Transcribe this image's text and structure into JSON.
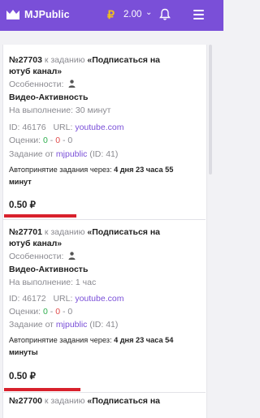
{
  "header": {
    "logo_text": "MJPublic",
    "currency_icon": "ruble-icon",
    "balance": "2.00",
    "colors": {
      "bar": "#7a4fd8",
      "ruble": "#f3c318"
    }
  },
  "tasks": [
    {
      "number": "№27703",
      "to_task_label": "к заданию",
      "title_line1": "«Подписаться на",
      "title_line2": "ютуб канал»",
      "features_label": "Особенности:",
      "category": "Видео-Активность",
      "duration_label": "На выполнение:",
      "duration": "30 минут",
      "id_label": "ID:",
      "id": "46176",
      "url_label": "URL:",
      "url": "youtube.com",
      "ratings_label": "Оценки:",
      "rating_pos": "0",
      "rating_dash1": "-",
      "rating_neg": "0",
      "rating_dash2": "-",
      "rating_other": "0",
      "from_label": "Задание от",
      "author": "mjpublic",
      "author_id": "(ID: 41)",
      "auto_label": "Автопринятие задания через:",
      "auto_time_a": "4 дня 23 часа 55",
      "auto_time_b": "минут",
      "price": "0.50 ₽"
    },
    {
      "number": "№27701",
      "to_task_label": "к заданию",
      "title_line1": "«Подписаться на",
      "title_line2": "ютуб канал»",
      "features_label": "Особенности:",
      "category": "Видео-Активность",
      "duration_label": "На выполнение:",
      "duration": "1 час",
      "id_label": "ID:",
      "id": "46172",
      "url_label": "URL:",
      "url": "youtube.com",
      "ratings_label": "Оценки:",
      "rating_pos": "0",
      "rating_dash1": "-",
      "rating_neg": "0",
      "rating_dash2": "-",
      "rating_other": "0",
      "from_label": "Задание от",
      "author": "mjpublic",
      "author_id": "(ID: 41)",
      "auto_label": "Автопринятие задания через:",
      "auto_time_a": "4 дня 23 часа 54",
      "auto_time_b": "минуты",
      "price": "0.50 ₽"
    },
    {
      "number": "№27700",
      "to_task_label": "к заданию",
      "title_line1": "«Подписаться на"
    }
  ]
}
